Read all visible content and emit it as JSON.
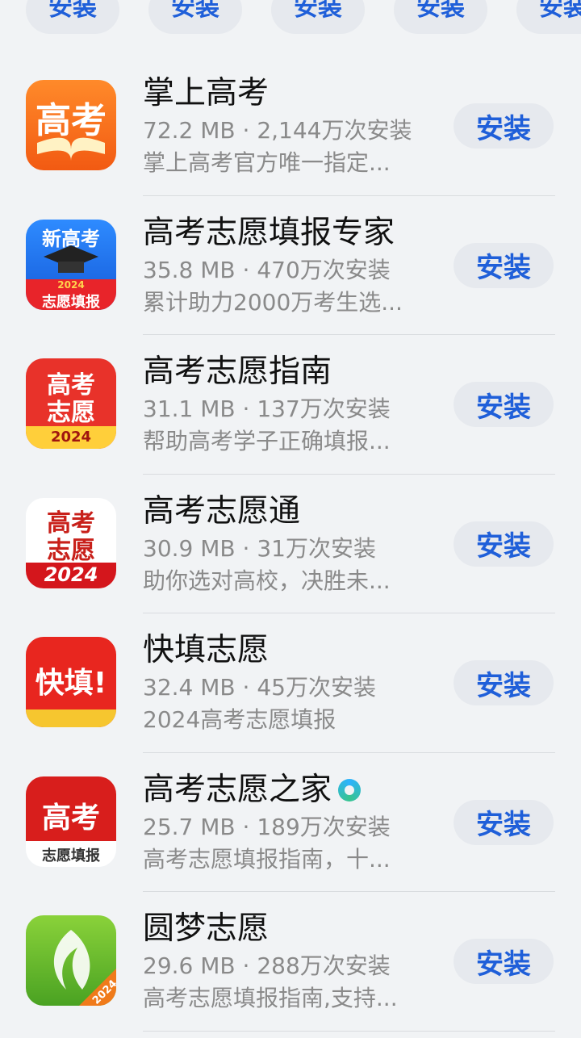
{
  "top_strip": {
    "install_label": "安装"
  },
  "apps": [
    {
      "name": "掌上高考",
      "meta": "72.2 MB · 2,144万次安装",
      "desc": "掌上高考官方唯一指定...",
      "install": "安装",
      "icon": {
        "name": "gaokao-book-icon",
        "text": "高考"
      }
    },
    {
      "name": "高考志愿填报专家",
      "meta": "35.8 MB · 470万次安装",
      "desc": "累计助力2000万考生选...",
      "install": "安装",
      "icon": {
        "name": "graduation-cap-icon",
        "top": "新高考",
        "year": "2024",
        "bottom": "志愿填报"
      }
    },
    {
      "name": "高考志愿指南",
      "meta": "31.1 MB · 137万次安装",
      "desc": "帮助高考学子正确填报...",
      "install": "安装",
      "icon": {
        "name": "gaokao-zhiyuan-icon",
        "line1": "高考",
        "line2": "志愿",
        "year": "2024"
      }
    },
    {
      "name": "高考志愿通",
      "meta": "30.9 MB · 31万次安装",
      "desc": "助你选对高校，决胜未...",
      "install": "安装",
      "icon": {
        "name": "gaokao-zhiyuan-calligraphy-icon",
        "line1": "高考",
        "line2": "志愿",
        "year": "2024"
      }
    },
    {
      "name": "快填志愿",
      "meta": "32.4 MB · 45万次安装",
      "desc": "2024高考志愿填报",
      "install": "安装",
      "icon": {
        "name": "kuaitian-icon",
        "text": "快填!"
      }
    },
    {
      "name": "高考志愿之家",
      "meta": "25.7 MB · 189万次安装",
      "desc": "高考志愿填报指南，十...",
      "install": "安装",
      "verified": true,
      "icon": {
        "name": "gaokao-cap-icon",
        "text": "高考",
        "bottom": "志愿填报"
      }
    },
    {
      "name": "圆梦志愿",
      "meta": "29.6 MB · 288万次安装",
      "desc": "高考志愿填报指南,支持...",
      "install": "安装",
      "icon": {
        "name": "yuanmeng-leaf-icon",
        "year": "2024"
      }
    }
  ]
}
